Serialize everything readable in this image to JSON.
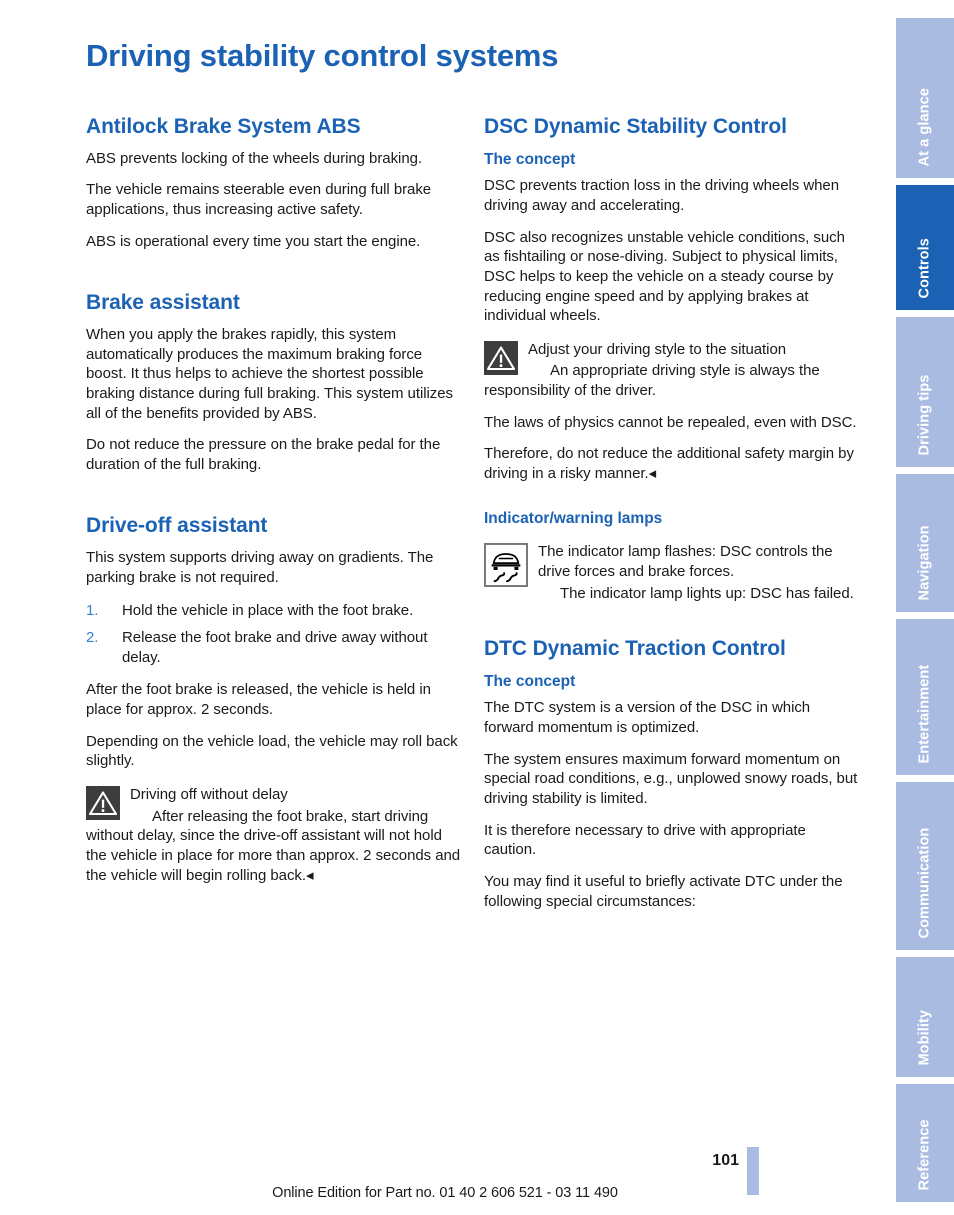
{
  "document": {
    "page_title": "Driving stability control systems",
    "page_number": "101",
    "edition_line": "Online Edition for Part no. 01 40 2 606 521 - 03 11 490"
  },
  "tab_rail": {
    "tabs": [
      {
        "label": "At a glance",
        "active": false
      },
      {
        "label": "Controls",
        "active": true
      },
      {
        "label": "Driving tips",
        "active": false
      },
      {
        "label": "Navigation",
        "active": false
      },
      {
        "label": "Entertainment",
        "active": false
      },
      {
        "label": "Communication",
        "active": false
      },
      {
        "label": "Mobility",
        "active": false
      },
      {
        "label": "Reference",
        "active": false
      }
    ],
    "colors": {
      "inactive": "#aabbe2",
      "active": "#1c62b4",
      "label": "#ffffff"
    }
  },
  "colors": {
    "heading_blue": "#1c62b4",
    "step_number_blue": "#3a7fd0",
    "body_text": "#1a1a1a",
    "warning_icon_bg": "#3d3d3d",
    "page_bar": "#aabbe2"
  },
  "left_column": {
    "abs": {
      "heading": "Antilock Brake System ABS",
      "paragraphs": [
        "ABS prevents locking of the wheels during braking.",
        "The vehicle remains steerable even during full brake applications, thus increasing active safety.",
        "ABS is operational every time you start the engine."
      ]
    },
    "brake_assistant": {
      "heading": "Brake assistant",
      "paragraphs": [
        "When you apply the brakes rapidly, this system automatically produces the maximum braking force boost. It thus helps to achieve the shortest possible braking distance during full braking. This system utilizes all of the benefits provided by ABS.",
        "Do not reduce the pressure on the brake pedal for the duration of the full braking."
      ]
    },
    "drive_off_assistant": {
      "heading": "Drive-off assistant",
      "intro": "This system supports driving away on gradients. The parking brake is not required.",
      "steps": [
        {
          "num": "1.",
          "text": "Hold the vehicle in place with the foot brake."
        },
        {
          "num": "2.",
          "text": "Release the foot brake and drive away without delay."
        }
      ],
      "paragraphs_after": [
        "After the foot brake is released, the vehicle is held in place for approx. 2 seconds.",
        "Depending on the vehicle load, the vehicle may roll back slightly."
      ],
      "warning": {
        "icon": "warning-triangle-icon",
        "title": "Driving off without delay",
        "body": "After releasing the foot brake, start driving without delay, since the drive-off assistant will not hold the vehicle in place for more than approx. 2 seconds and the vehicle will begin rolling back.◂"
      }
    }
  },
  "right_column": {
    "dsc": {
      "heading": "DSC Dynamic Stability Control",
      "concept_heading": "The concept",
      "paragraphs": [
        "DSC prevents traction loss in the driving wheels when driving away and accelerating.",
        "DSC also recognizes unstable vehicle conditions, such as fishtailing or nose-diving. Subject to physical limits, DSC helps to keep the vehicle on a steady course by reducing engine speed and by applying brakes at individual wheels."
      ],
      "warning": {
        "icon": "warning-triangle-icon",
        "title": "Adjust your driving style to the situation",
        "body": "An appropriate driving style is always the responsibility of the driver."
      },
      "paragraphs_after": [
        "The laws of physics cannot be repealed, even with DSC.",
        "Therefore, do not reduce the additional safety margin by driving in a risky manner.◂"
      ],
      "lamps_heading": "Indicator/warning lamps",
      "lamp": {
        "icon": "dsc-indicator-lamp-icon",
        "line1": "The indicator lamp flashes: DSC controls the drive forces and brake forces.",
        "line2": "The indicator lamp lights up: DSC has failed."
      }
    },
    "dtc": {
      "heading": "DTC Dynamic Traction Control",
      "concept_heading": "The concept",
      "paragraphs": [
        "The DTC system is a version of the DSC in which forward momentum is optimized.",
        "The system ensures maximum forward momentum on special road conditions, e.g., unplowed snowy roads, but driving stability is limited.",
        "It is therefore necessary to drive with appropriate caution.",
        "You may find it useful to briefly activate DTC under the following special circumstances:"
      ]
    }
  }
}
